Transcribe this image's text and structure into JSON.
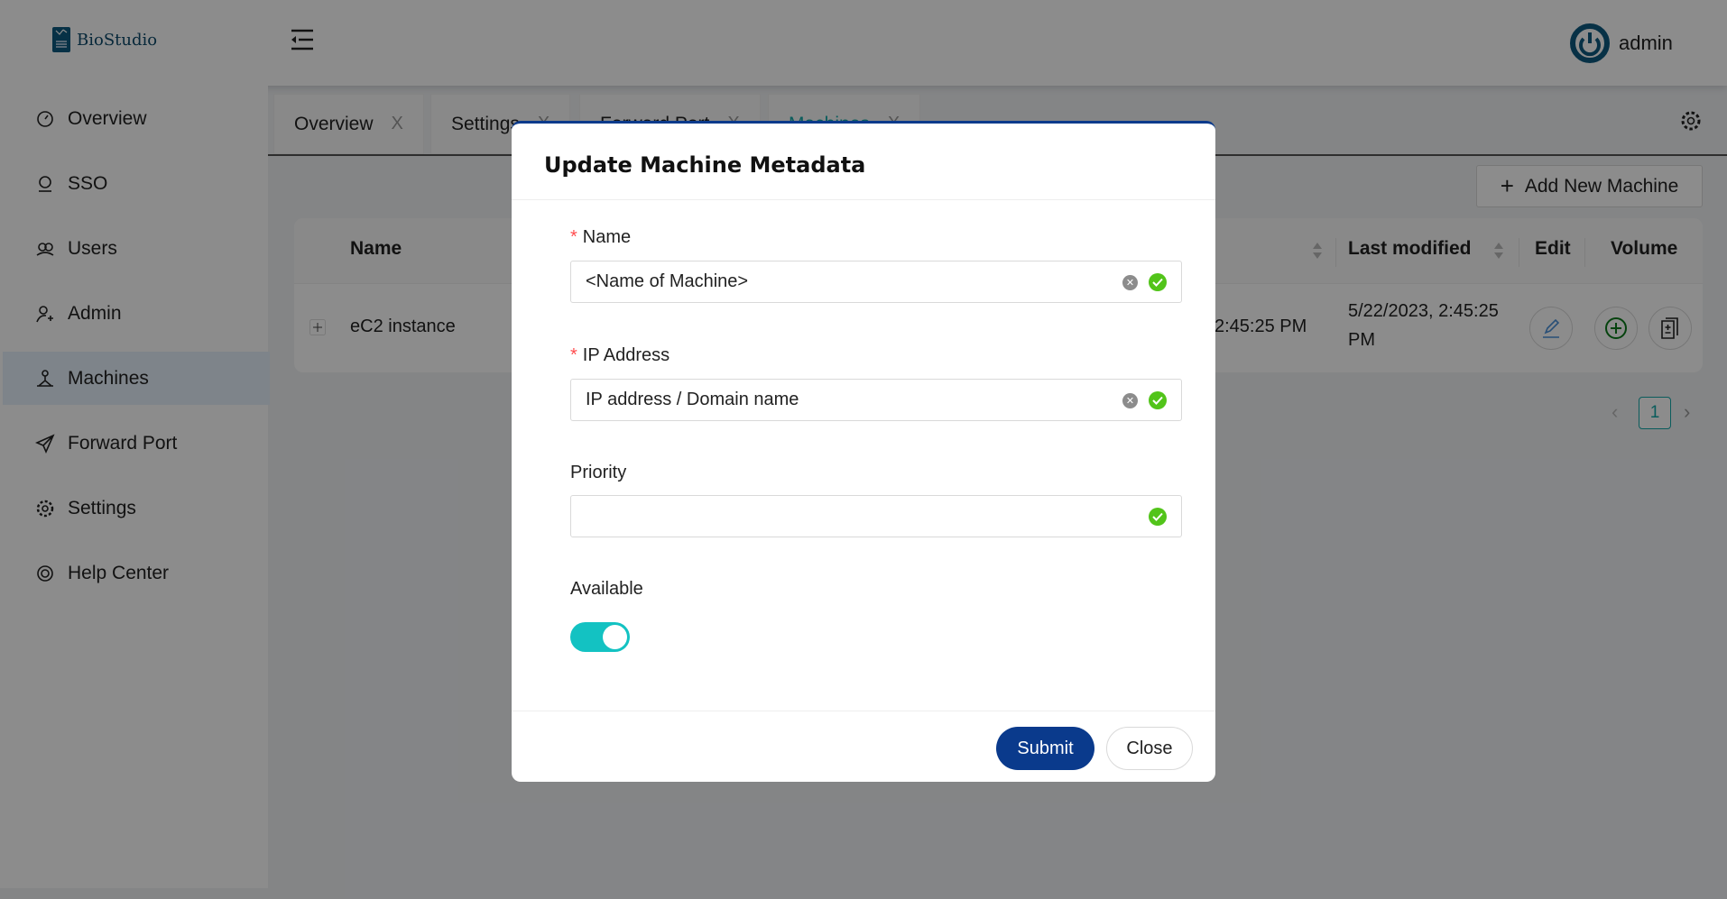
{
  "app": {
    "name": "BioStudio",
    "user": "admin",
    "accent": "#0a3a8c",
    "brand": "#0d5a80"
  },
  "sidebar": {
    "items": [
      {
        "label": "Overview",
        "icon": "dashboard-icon"
      },
      {
        "label": "SSO",
        "icon": "sso-icon"
      },
      {
        "label": "Users",
        "icon": "users-icon"
      },
      {
        "label": "Admin",
        "icon": "admin-icon"
      },
      {
        "label": "Machines",
        "icon": "machines-icon",
        "selected": true
      },
      {
        "label": "Forward Port",
        "icon": "send-icon"
      },
      {
        "label": "Settings",
        "icon": "gear-icon"
      },
      {
        "label": "Help Center",
        "icon": "help-icon"
      }
    ]
  },
  "tabs": [
    {
      "label": "Overview"
    },
    {
      "label": "Settings"
    },
    {
      "label": "Forward Port"
    },
    {
      "label": "Machines",
      "active": true
    }
  ],
  "tab_close": "X",
  "toolbar": {
    "add_label": "Add New Machine"
  },
  "table": {
    "columns": {
      "name": "Name",
      "last_modified": "Last modified",
      "edit": "Edit",
      "volume": "Volume"
    },
    "rows": [
      {
        "name": "eC2 instance",
        "created": "2:45:25 PM",
        "last_modified_line1": "5/22/2023, 2:45:25",
        "last_modified_line2": "PM"
      }
    ]
  },
  "pagination": {
    "current": "1"
  },
  "modal": {
    "title": "Update Machine Metadata",
    "fields": {
      "name": {
        "label": "Name",
        "required": "*",
        "value": "<Name of Machine>"
      },
      "ip": {
        "label": "IP Address",
        "required": "*",
        "value": "IP address / Domain name"
      },
      "priority": {
        "label": "Priority",
        "value": ""
      },
      "available": {
        "label": "Available",
        "value": true
      }
    },
    "submit_label": "Submit",
    "close_label": "Close"
  }
}
